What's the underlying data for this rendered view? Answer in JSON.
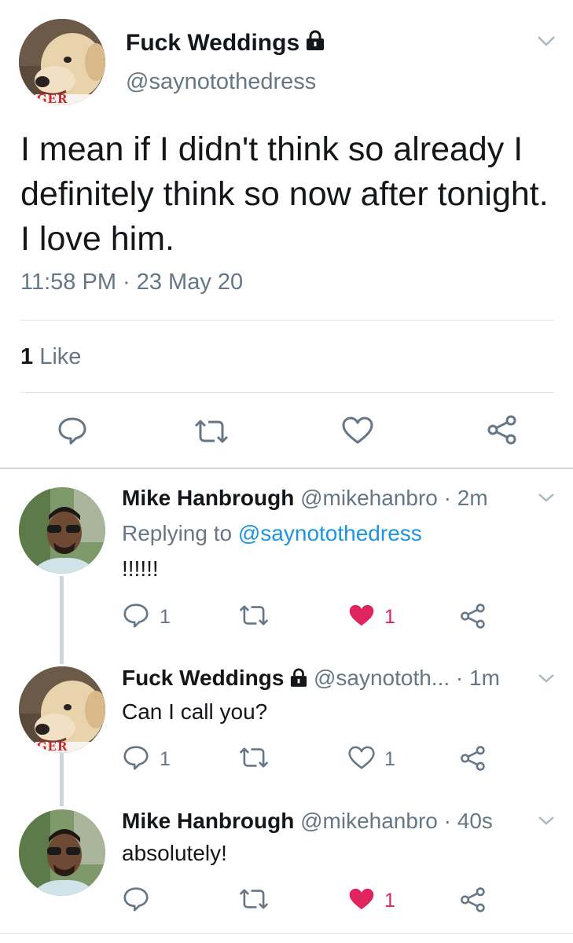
{
  "main_tweet": {
    "name": "Fuck Weddings",
    "handle": "@saynotothedress",
    "text": "I mean if I didn't think so already I definitely think so now after tonight. I love him.",
    "timestamp": "11:58 PM · 23 May 20",
    "likes_count": "1",
    "likes_label": "Like",
    "avatar_caption": "NGER"
  },
  "replies": [
    {
      "name": "Mike Hanbrough",
      "handle": "@mikehanbro",
      "time": "· 2m",
      "replying_prefix": "Replying to",
      "replying_to": "@saynotothedress",
      "text": "!!!!!!",
      "reply_count": "1",
      "like_count": "1",
      "liked": true
    },
    {
      "name": "Fuck Weddings",
      "handle": "@saynototh...",
      "time": "· 1m",
      "text": "Can I call you?",
      "reply_count": "1",
      "like_count": "1",
      "liked": false,
      "avatar_caption": "NGER"
    },
    {
      "name": "Mike Hanbrough",
      "handle": "@mikehanbro",
      "time": "· 40s",
      "text": "absolutely!",
      "like_count": "1",
      "liked": true
    }
  ],
  "icons": {
    "reply": "reply-bubble-icon",
    "retweet": "retweet-icon",
    "like": "heart-icon",
    "share": "share-icon",
    "lock": "lock-icon",
    "menu": "chevron-down-icon"
  },
  "colors": {
    "text": "#14171a",
    "secondary": "#657786",
    "link": "#1b95e0",
    "like_red": "#e0245e",
    "divider": "#e1e8ed",
    "icon_gray": "#657786"
  }
}
